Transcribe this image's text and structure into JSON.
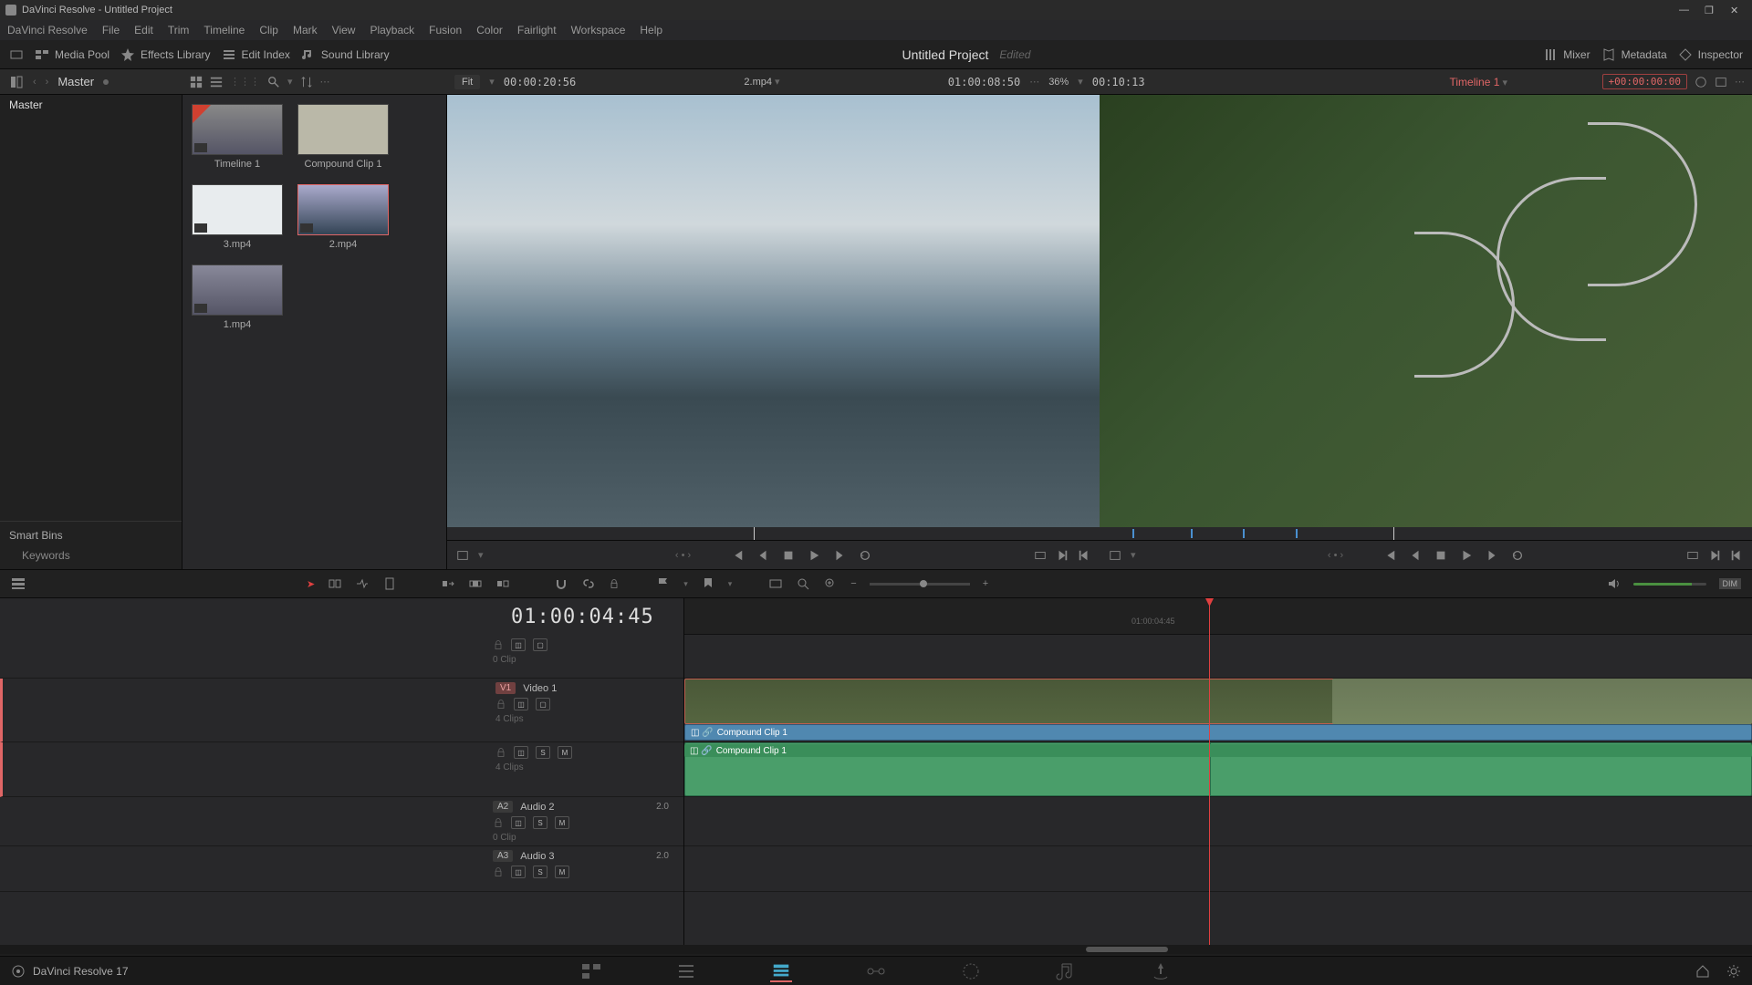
{
  "title_bar": {
    "app": "DaVinci Resolve",
    "doc": "Untitled Project"
  },
  "window_controls": {
    "min": "—",
    "max": "❐",
    "close": "✕"
  },
  "menu": [
    "DaVinci Resolve",
    "File",
    "Edit",
    "Trim",
    "Timeline",
    "Clip",
    "Mark",
    "View",
    "Playback",
    "Fusion",
    "Color",
    "Fairlight",
    "Workspace",
    "Help"
  ],
  "toolbar": {
    "media_pool": "Media Pool",
    "effects_lib": "Effects Library",
    "edit_index": "Edit Index",
    "sound_lib": "Sound Library",
    "project": "Untitled Project",
    "status": "Edited",
    "mixer": "Mixer",
    "metadata": "Metadata",
    "inspector": "Inspector"
  },
  "sub_bar": {
    "master": "Master",
    "fit": "Fit",
    "src_tc": "00:00:20:56",
    "src_name": "2.mp4",
    "prog_tc": "01:00:08:50",
    "zoom": "36%",
    "dur_tc": "00:10:13",
    "timeline_name": "Timeline 1",
    "rec_tc": "+00:00:00:00"
  },
  "media_panel": {
    "root": "Master",
    "smart_bins": "Smart Bins",
    "keywords": "Keywords"
  },
  "thumbs": [
    {
      "label": "Timeline 1"
    },
    {
      "label": "Compound Clip 1"
    },
    {
      "label": "3.mp4"
    },
    {
      "label": "2.mp4"
    },
    {
      "label": "1.mp4"
    }
  ],
  "timeline": {
    "playhead_tc": "01:00:04:45",
    "ruler_tc": "01:00:04:45",
    "tracks": {
      "v2": {
        "sub": "0 Clip"
      },
      "v1": {
        "tag": "V1",
        "name": "Video 1",
        "sub": "4 Clips"
      },
      "a1": {
        "sub": "4 Clips"
      },
      "a2": {
        "tag": "A2",
        "name": "Audio 2",
        "ch": "2.0",
        "sub": "0 Clip"
      },
      "a3": {
        "tag": "A3",
        "name": "Audio 3",
        "ch": "2.0"
      }
    },
    "clips": {
      "compound": "Compound Clip 1"
    },
    "dim": "DIM",
    "sm": {
      "s": "S",
      "m": "M"
    }
  },
  "footer": {
    "app_ver": "DaVinci Resolve 17"
  }
}
